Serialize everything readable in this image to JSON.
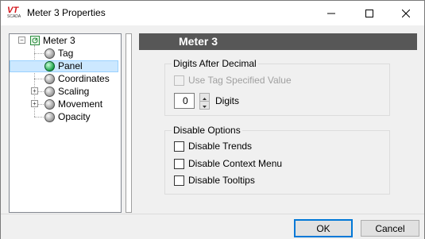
{
  "window": {
    "title": "Meter 3 Properties",
    "app_icon": {
      "logo": "VT",
      "sub": "SCADA"
    }
  },
  "tree": {
    "root": {
      "label": "Meter 3",
      "expander": "−"
    },
    "items": [
      {
        "label": "Tag",
        "icon": "gray-circle-icon"
      },
      {
        "label": "Panel",
        "icon": "green-circle-icon",
        "selected": true
      },
      {
        "label": "Coordinates",
        "icon": "gray-circle-icon"
      },
      {
        "label": "Scaling",
        "icon": "gray-circle-icon",
        "expander": "+"
      },
      {
        "label": "Movement",
        "icon": "gray-circle-icon",
        "expander": "+"
      },
      {
        "label": "Opacity",
        "icon": "gray-circle-icon"
      }
    ]
  },
  "panel": {
    "header": "Meter 3",
    "digits_group": {
      "title": "Digits After Decimal",
      "use_tag_label": "Use Tag Specified Value",
      "digits_value": "0",
      "digits_label": "Digits"
    },
    "disable_group": {
      "title": "Disable Options",
      "options": [
        "Disable Trends",
        "Disable Context Menu",
        "Disable Tooltips"
      ]
    }
  },
  "buttons": {
    "ok": "OK",
    "cancel": "Cancel"
  },
  "colors": {
    "header_bg": "#575757",
    "selection": "#cce8ff",
    "accent": "#0078d7"
  }
}
